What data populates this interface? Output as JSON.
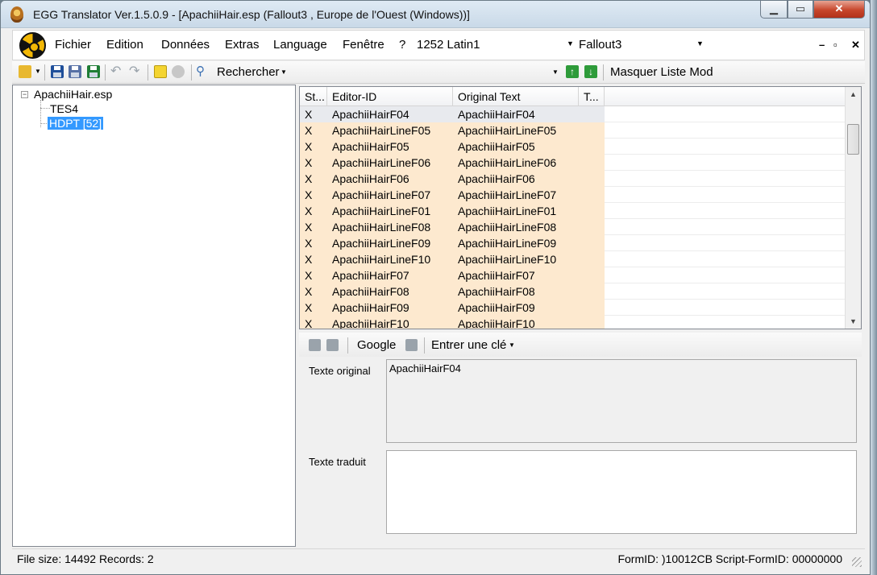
{
  "window": {
    "title": "EGG Translator Ver.1.5.0.9 - [ApachiiHair.esp (Fallout3 , Europe de l'Ouest (Windows))]",
    "minimize": "▁",
    "maximize": "▭",
    "close": "✕"
  },
  "menubar": {
    "items": [
      "Fichier",
      "Edition",
      "Données",
      "Extras",
      "Language",
      "Fenêtre",
      "?"
    ],
    "encoding": "1252 Latin1",
    "game": "Fallout3",
    "mdi_min": "–",
    "mdi_restore": "▫",
    "mdi_close": "✕"
  },
  "toolbar": {
    "search_label": "Rechercher",
    "search_value": "",
    "hide_mod_list": "Masquer Liste Mod",
    "up_arrow": "↑",
    "down_arrow": "↓"
  },
  "tree": {
    "root": "ApachiiHair.esp",
    "children": [
      "TES4",
      "HDPT [52]"
    ],
    "selected_index": 1
  },
  "grid": {
    "columns": [
      "St...",
      "Editor-ID",
      "Original Text",
      "T..."
    ],
    "rows": [
      [
        "X",
        "ApachiiHairF04",
        "ApachiiHairF04",
        ""
      ],
      [
        "X",
        "ApachiiHairLineF05",
        "ApachiiHairLineF05",
        ""
      ],
      [
        "X",
        "ApachiiHairF05",
        "ApachiiHairF05",
        ""
      ],
      [
        "X",
        "ApachiiHairLineF06",
        "ApachiiHairLineF06",
        ""
      ],
      [
        "X",
        "ApachiiHairF06",
        "ApachiiHairF06",
        ""
      ],
      [
        "X",
        "ApachiiHairLineF07",
        "ApachiiHairLineF07",
        ""
      ],
      [
        "X",
        "ApachiiHairLineF01",
        "ApachiiHairLineF01",
        ""
      ],
      [
        "X",
        "ApachiiHairLineF08",
        "ApachiiHairLineF08",
        ""
      ],
      [
        "X",
        "ApachiiHairLineF09",
        "ApachiiHairLineF09",
        ""
      ],
      [
        "X",
        "ApachiiHairLineF10",
        "ApachiiHairLineF10",
        ""
      ],
      [
        "X",
        "ApachiiHairF07",
        "ApachiiHairF07",
        ""
      ],
      [
        "X",
        "ApachiiHairF08",
        "ApachiiHairF08",
        ""
      ],
      [
        "X",
        "ApachiiHairF09",
        "ApachiiHairF09",
        ""
      ],
      [
        "X",
        "ApachiiHairF10",
        "ApachiiHairF10",
        ""
      ]
    ],
    "highlight_color": "#fde9cf"
  },
  "detail": {
    "google": "Google",
    "enter_key": "Entrer une clé",
    "original_label": "Texte original",
    "original_value": "ApachiiHairF04",
    "translated_label": "Texte traduit",
    "translated_value": ""
  },
  "status": {
    "left": "File size: 14492 Records: 2",
    "right": "FormID: )10012CB Script-FormID:  00000000"
  }
}
